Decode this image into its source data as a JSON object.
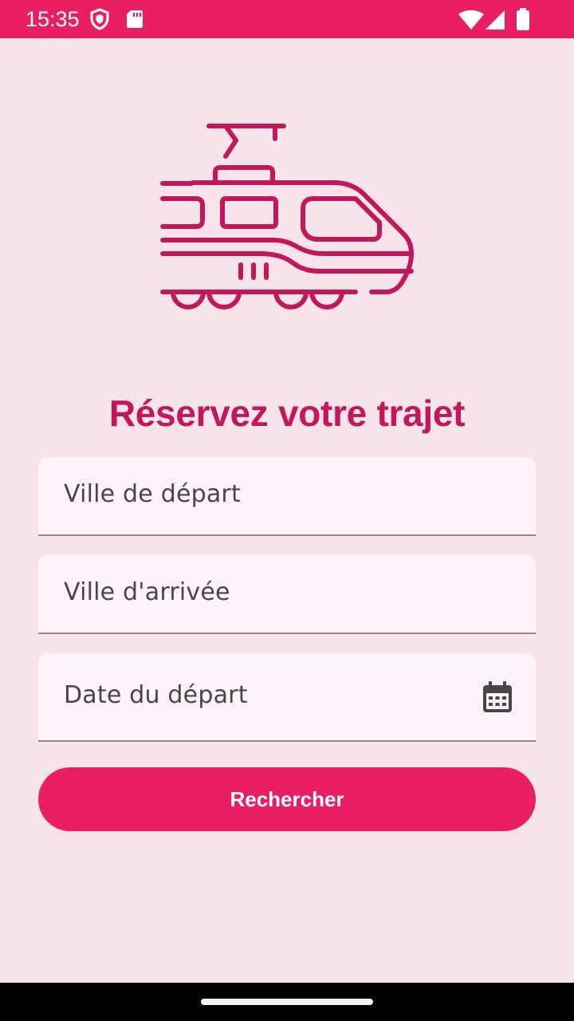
{
  "status_bar": {
    "time": "15:35",
    "icons": [
      "shield-icon",
      "sd-card-icon",
      "wifi-icon",
      "signal-icon",
      "battery-icon"
    ]
  },
  "hero": {
    "icon": "train-icon"
  },
  "title": "Réservez votre trajet",
  "form": {
    "departure_city_placeholder": "Ville de départ",
    "arrival_city_placeholder": "Ville d'arrivée",
    "departure_date_placeholder": "Date du départ",
    "date_icon": "calendar-icon",
    "search_button_label": "Rechercher"
  },
  "colors": {
    "accent": "#e91e63",
    "title": "#c2185b",
    "background": "#f9e4ea",
    "field_background": "#fdf3fa"
  }
}
